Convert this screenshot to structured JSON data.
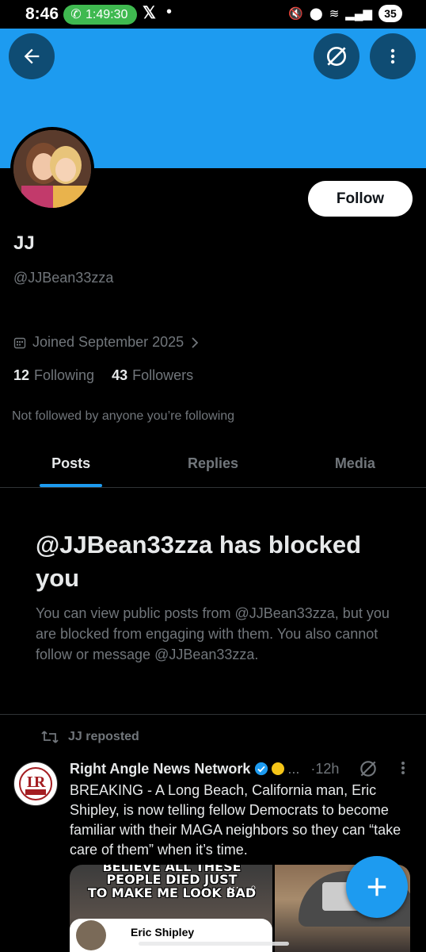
{
  "status_bar": {
    "time": "8:46",
    "call_timer": "1:49:30",
    "x_logo": "𝕏",
    "dot": "•",
    "battery": "35"
  },
  "profile": {
    "display_name": "JJ",
    "handle": "@JJBean33zza",
    "follow_label": "Follow",
    "joined": "Joined September 2025",
    "following_count": "12",
    "following_label": "Following",
    "followers_count": "43",
    "followers_label": "Followers",
    "not_followed_note": "Not followed by anyone you’re following"
  },
  "tabs": [
    {
      "label": "Posts",
      "active": true
    },
    {
      "label": "Replies",
      "active": false
    },
    {
      "label": "Media",
      "active": false
    }
  ],
  "blocked": {
    "title": "@JJBean33zza has blocked you",
    "description": "You can view public posts from @JJBean33zza, but you are blocked from engaging with them. You also cannot follow or message @JJBean33zza."
  },
  "tweet": {
    "repost_label": "JJ reposted",
    "author_name": "Right Angle News Network",
    "ellipsis": "...",
    "time": "·12h",
    "text": "BREAKING - A Long Beach, California man, Eric Shipley, is now telling fellow Democrats to become familiar with their MAGA neighbors so they can “take care of them” when it’s time.",
    "media_left_meme_lines": [
      "BELIEVE ALL THESE",
      "PEOPLE DIED JUST",
      "TO MAKE ME LOOK BAD"
    ],
    "media_left_card_name": "Eric Shipley"
  },
  "colors": {
    "accent": "#1d9bf0",
    "background": "#000000",
    "muted_text": "#71767b",
    "primary_text": "#e7e9ea"
  },
  "icons": {
    "back": "arrow-left-icon",
    "grok": "grok-icon",
    "more": "more-vertical-icon",
    "calendar": "calendar-icon",
    "chevron": "chevron-right-icon",
    "repost": "repost-icon",
    "verified": "verified-badge-icon",
    "compose": "plus-icon"
  }
}
